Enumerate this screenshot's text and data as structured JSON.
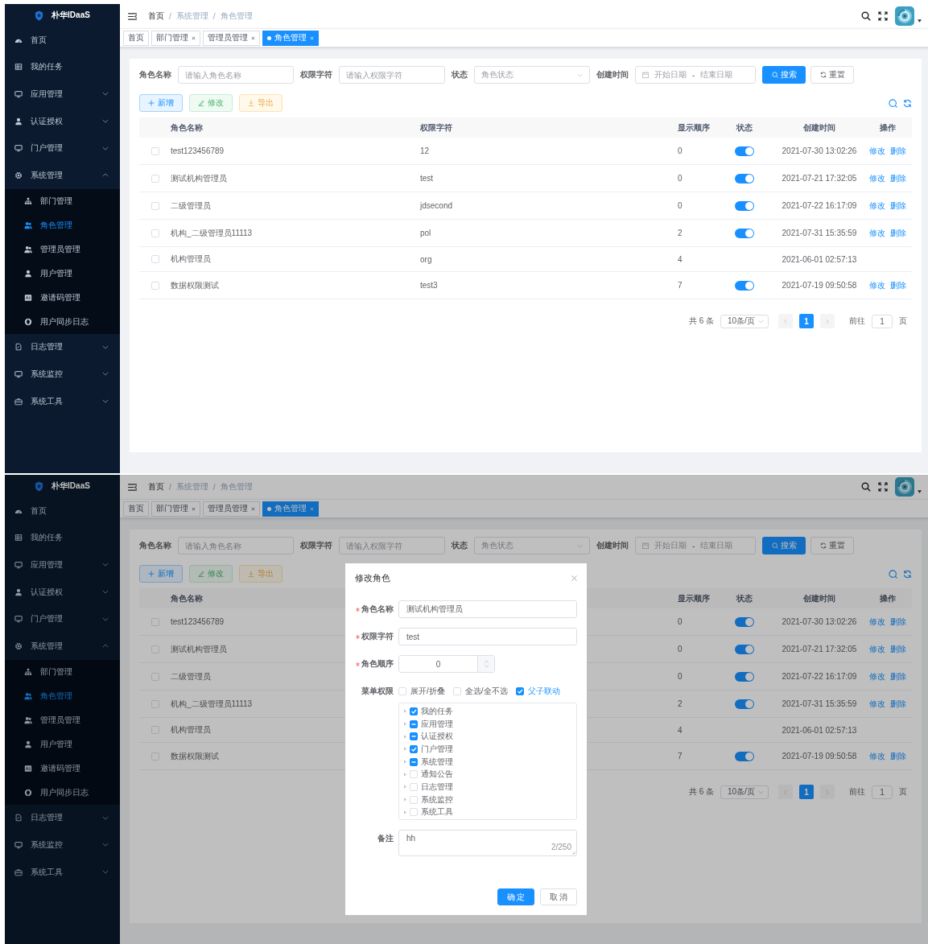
{
  "screens": [
    {
      "sidebar": {
        "logo": "朴华IDaaS",
        "items": [
          {
            "label": "首页",
            "selected": false
          },
          {
            "label": "我的任务",
            "selected": false
          },
          {
            "label": "应用管理",
            "selected": false,
            "expanded": false
          },
          {
            "label": "认证授权",
            "selected": false,
            "expanded": false
          },
          {
            "label": "门户管理",
            "selected": false,
            "expanded": false
          },
          {
            "label": "系统管理",
            "selected": false,
            "expanded": true,
            "children": [
              {
                "label": "部门管理",
                "selected": false
              },
              {
                "label": "角色管理",
                "selected": true
              },
              {
                "label": "管理员管理",
                "selected": false
              },
              {
                "label": "用户管理",
                "selected": false
              },
              {
                "label": "邀请码管理",
                "selected": false
              },
              {
                "label": "用户同步日志",
                "selected": false
              }
            ]
          },
          {
            "label": "日志管理",
            "selected": false,
            "expanded": false
          },
          {
            "label": "系统监控",
            "selected": false,
            "expanded": false
          },
          {
            "label": "系统工具",
            "selected": false,
            "expanded": false
          }
        ]
      },
      "breadcrumb": [
        "首页",
        "系统管理",
        "角色管理"
      ],
      "breadcrumb_separator": "/",
      "tags": [
        {
          "label": "首页",
          "selected": false,
          "closable": false
        },
        {
          "label": "部门管理",
          "selected": false,
          "closable": true
        },
        {
          "label": "管理员管理",
          "selected": false,
          "closable": true
        },
        {
          "label": "角色管理",
          "selected": true,
          "closable": true
        }
      ],
      "filters": [
        {
          "kind": "input",
          "label": "角色名称",
          "placeholder": "请输入角色名称"
        },
        {
          "kind": "input",
          "label": "权限字符",
          "placeholder": "请输入权限字符"
        },
        {
          "kind": "select",
          "label": "状态",
          "placeholder": "角色状态"
        },
        {
          "kind": "daterange",
          "label": "创建时间",
          "start": "开始日期",
          "separator": "-",
          "end": "结束日期"
        }
      ],
      "search_button": "搜索",
      "reset_button": "重置",
      "toolbar": [
        {
          "kind": "primary",
          "label": "新增"
        },
        {
          "kind": "success",
          "label": "修改"
        },
        {
          "kind": "warning",
          "label": "导出"
        }
      ],
      "table": {
        "columns": {
          "name": "角色名称",
          "key": "权限字符",
          "order": "显示顺序",
          "status": "状态",
          "created": "创建时间",
          "actions": "操作"
        },
        "rows": [
          {
            "checked": false,
            "name": "test123456789",
            "key": "12",
            "order": "0",
            "switch": {
              "on": true
            },
            "created": "2021-07-30 13:02:26",
            "actions": [
              "修改",
              "删除"
            ]
          },
          {
            "checked": false,
            "name": "测试机构管理员",
            "key": "test",
            "order": "0",
            "switch": {
              "on": true
            },
            "created": "2021-07-21 17:32:05",
            "actions": [
              "修改",
              "删除"
            ]
          },
          {
            "checked": false,
            "name": "二级管理员",
            "key": "jdsecond",
            "order": "0",
            "switch": {
              "on": true
            },
            "created": "2021-07-22 16:17:09",
            "actions": [
              "修改",
              "删除"
            ]
          },
          {
            "checked": false,
            "name": "机构_二级管理员11113",
            "key": "pol",
            "order": "2",
            "switch": {
              "on": true
            },
            "created": "2021-07-31 15:35:59",
            "actions": [
              "修改",
              "删除"
            ]
          },
          {
            "checked": false,
            "name": "机构管理员",
            "key": "org",
            "order": "4",
            "created": "2021-06-01 02:57:13"
          },
          {
            "checked": false,
            "name": "数据权限测试",
            "key": "test3",
            "order": "7",
            "switch": {
              "on": true
            },
            "created": "2021-07-19 09:50:58",
            "actions": [
              "修改",
              "删除"
            ]
          }
        ]
      },
      "pagination": {
        "total": "共 6 条",
        "page_size": "10条/页",
        "pages": [
          {
            "label": "1",
            "selected": true
          }
        ],
        "goto_label": "前往",
        "goto_value": "1",
        "goto_suffix": "页"
      }
    },
    {
      "sidebar": {
        "logo": "朴华IDaaS",
        "items": [
          {
            "label": "首页",
            "selected": false
          },
          {
            "label": "我的任务",
            "selected": false
          },
          {
            "label": "应用管理",
            "selected": false,
            "expanded": false
          },
          {
            "label": "认证授权",
            "selected": false,
            "expanded": false
          },
          {
            "label": "门户管理",
            "selected": false,
            "expanded": false
          },
          {
            "label": "系统管理",
            "selected": false,
            "expanded": true,
            "children": [
              {
                "label": "部门管理",
                "selected": false
              },
              {
                "label": "角色管理",
                "selected": true
              },
              {
                "label": "管理员管理",
                "selected": false
              },
              {
                "label": "用户管理",
                "selected": false
              },
              {
                "label": "邀请码管理",
                "selected": false
              },
              {
                "label": "用户同步日志",
                "selected": false
              }
            ]
          },
          {
            "label": "日志管理",
            "selected": false,
            "expanded": false
          },
          {
            "label": "系统监控",
            "selected": false,
            "expanded": false
          },
          {
            "label": "系统工具",
            "selected": false,
            "expanded": false
          }
        ]
      },
      "breadcrumb": [
        "首页",
        "系统管理",
        "角色管理"
      ],
      "breadcrumb_separator": "/",
      "tags": [
        {
          "label": "首页",
          "selected": false,
          "closable": false
        },
        {
          "label": "部门管理",
          "selected": false,
          "closable": true
        },
        {
          "label": "管理员管理",
          "selected": false,
          "closable": true
        },
        {
          "label": "角色管理",
          "selected": true,
          "closable": true
        }
      ],
      "filters": [
        {
          "kind": "input",
          "label": "角色名称",
          "placeholder": "请输入角色名称"
        },
        {
          "kind": "input",
          "label": "权限字符",
          "placeholder": "请输入权限字符"
        },
        {
          "kind": "select",
          "label": "状态",
          "placeholder": "角色状态"
        },
        {
          "kind": "daterange",
          "label": "创建时间",
          "start": "开始日期",
          "separator": "-",
          "end": "结束日期"
        }
      ],
      "search_button": "搜索",
      "reset_button": "重置",
      "toolbar": [
        {
          "kind": "primary",
          "label": "新增"
        },
        {
          "kind": "success",
          "label": "修改"
        },
        {
          "kind": "warning",
          "label": "导出"
        }
      ],
      "table": {
        "columns": {
          "name": "角色名称",
          "order": "显示顺序",
          "status": "状态",
          "created": "创建时间",
          "actions": "操作"
        },
        "rows": [
          {
            "checked": false,
            "name": "test123456789",
            "order": "0",
            "switch": {
              "on": true
            },
            "created": "2021-07-30 13:02:26",
            "actions": [
              "修改",
              "删除"
            ]
          },
          {
            "checked": false,
            "name": "测试机构管理员",
            "order": "0",
            "switch": {
              "on": true
            },
            "created": "2021-07-21 17:32:05",
            "actions": [
              "修改",
              "删除"
            ]
          },
          {
            "checked": false,
            "name": "二级管理员",
            "order": "0",
            "switch": {
              "on": true
            },
            "created": "2021-07-22 16:17:09",
            "actions": [
              "修改",
              "删除"
            ]
          },
          {
            "checked": false,
            "name": "机构_二级管理员11113",
            "order": "2",
            "switch": {
              "on": true
            },
            "created": "2021-07-31 15:35:59",
            "actions": [
              "修改",
              "删除"
            ]
          },
          {
            "checked": false,
            "name": "机构管理员",
            "order": "4",
            "created": "2021-06-01 02:57:13"
          },
          {
            "checked": false,
            "name": "数据权限测试",
            "order": "7",
            "switch": {
              "on": true
            },
            "created": "2021-07-19 09:50:58",
            "actions": [
              "修改",
              "删除"
            ]
          }
        ]
      },
      "pagination": {
        "total": "共 6 条",
        "page_size": "10条/页",
        "pages": [
          {
            "label": "1",
            "selected": true
          }
        ],
        "goto_label": "前往",
        "goto_value": "1",
        "goto_suffix": "页"
      },
      "dialog": {
        "title": "修改角色",
        "fields": [
          {
            "kind": "input",
            "label": "角色名称",
            "required": true,
            "value": "测试机构管理员"
          },
          {
            "kind": "input",
            "label": "权限字符",
            "required": true,
            "value": "test"
          },
          {
            "kind": "number",
            "label": "角色顺序",
            "required": true,
            "value": "0"
          },
          {
            "kind": "tree",
            "label": "菜单权限",
            "required": false,
            "options": [
              {
                "label": "展开/折叠",
                "checked": false
              },
              {
                "label": "全选/全不选",
                "checked": false
              },
              {
                "label": "父子联动",
                "checked": true
              }
            ],
            "tree": [
              {
                "label": "我的任务",
                "checked": true,
                "indeterminate": false
              },
              {
                "label": "应用管理",
                "checked": false,
                "indeterminate": true
              },
              {
                "label": "认证授权",
                "checked": false,
                "indeterminate": true
              },
              {
                "label": "门户管理",
                "checked": true,
                "indeterminate": false
              },
              {
                "label": "系统管理",
                "checked": false,
                "indeterminate": true
              },
              {
                "label": "通知公告",
                "checked": false,
                "indeterminate": false
              },
              {
                "label": "日志管理",
                "checked": false,
                "indeterminate": false
              },
              {
                "label": "系统监控",
                "checked": false,
                "indeterminate": false
              },
              {
                "label": "系统工具",
                "checked": false,
                "indeterminate": false
              }
            ]
          },
          {
            "kind": "textarea",
            "label": "备注",
            "required": false,
            "value": "hh",
            "counter": "2/250"
          }
        ],
        "buttons": [
          {
            "kind": "primary",
            "label": "确 定"
          },
          {
            "kind": "default",
            "label": "取 消"
          }
        ]
      }
    }
  ]
}
